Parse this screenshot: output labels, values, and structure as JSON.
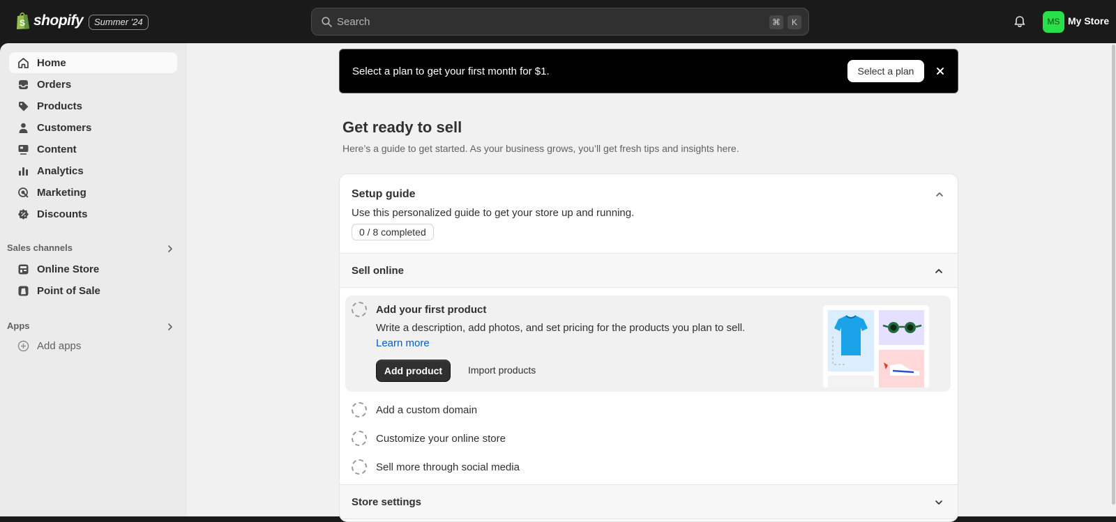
{
  "topbar": {
    "brand": "shopify",
    "edition": "Summer '24",
    "search_placeholder": "Search",
    "shortcut_keys": [
      "⌘",
      "K"
    ],
    "avatar_initials": "MS",
    "avatar_color": "#29e04a",
    "store_name": "My Store"
  },
  "sidebar": {
    "items": [
      {
        "label": "Home",
        "icon": "home-icon",
        "active": true
      },
      {
        "label": "Orders",
        "icon": "inbox-icon"
      },
      {
        "label": "Products",
        "icon": "tag-icon"
      },
      {
        "label": "Customers",
        "icon": "person-icon"
      },
      {
        "label": "Content",
        "icon": "content-icon"
      },
      {
        "label": "Analytics",
        "icon": "bar-chart-icon"
      },
      {
        "label": "Marketing",
        "icon": "target-icon"
      },
      {
        "label": "Discounts",
        "icon": "discount-icon"
      }
    ],
    "sales_channels_label": "Sales channels",
    "channels": [
      {
        "label": "Online Store",
        "icon": "store-icon"
      },
      {
        "label": "Point of Sale",
        "icon": "pos-icon"
      }
    ],
    "apps_label": "Apps",
    "add_apps_label": "Add apps"
  },
  "banner": {
    "text": "Select a plan to get your first month for $1.",
    "button": "Select a plan"
  },
  "main": {
    "title": "Get ready to sell",
    "subtitle": "Here’s a guide to get started. As your business grows, you’ll get fresh tips and insights here."
  },
  "setup_guide": {
    "title": "Setup guide",
    "description": "Use this personalized guide to get your store up and running.",
    "progress": "0 / 8 completed",
    "sell_online": {
      "title": "Sell online",
      "active_task": {
        "title": "Add your first product",
        "description": "Write a description, add photos, and set pricing for the products you plan to sell.",
        "link": "Learn more",
        "primary_button": "Add product",
        "secondary_button": "Import products"
      },
      "tasks": [
        "Add a custom domain",
        "Customize your online store",
        "Sell more through social media"
      ]
    },
    "store_settings_title": "Store settings"
  }
}
